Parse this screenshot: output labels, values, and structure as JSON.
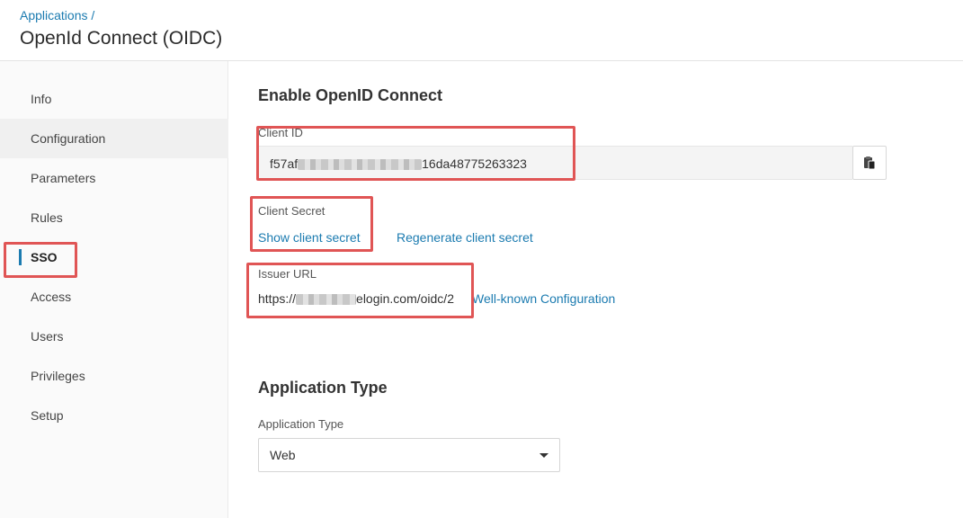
{
  "header": {
    "breadcrumb": "Applications /",
    "title": "OpenId Connect (OIDC)"
  },
  "sidebar": {
    "items": [
      {
        "label": "Info"
      },
      {
        "label": "Configuration"
      },
      {
        "label": "Parameters"
      },
      {
        "label": "Rules"
      },
      {
        "label": "SSO"
      },
      {
        "label": "Access"
      },
      {
        "label": "Users"
      },
      {
        "label": "Privileges"
      },
      {
        "label": "Setup"
      }
    ]
  },
  "main": {
    "section_oidc": "Enable OpenID Connect",
    "client_id": {
      "label": "Client ID",
      "value_prefix": "f57af",
      "value_suffix": "16da48775263323"
    },
    "client_secret": {
      "label": "Client Secret",
      "show_link": "Show client secret",
      "regenerate_link": "Regenerate client secret"
    },
    "issuer": {
      "label": "Issuer URL",
      "value_prefix": "https://",
      "value_suffix": "elogin.com/oidc/2",
      "well_known_link": "Well-known Configuration"
    },
    "section_app_type": "Application Type",
    "app_type": {
      "label": "Application Type",
      "selected": "Web"
    }
  },
  "colors": {
    "accent": "#1b7bb0",
    "highlight": "#e05555"
  }
}
